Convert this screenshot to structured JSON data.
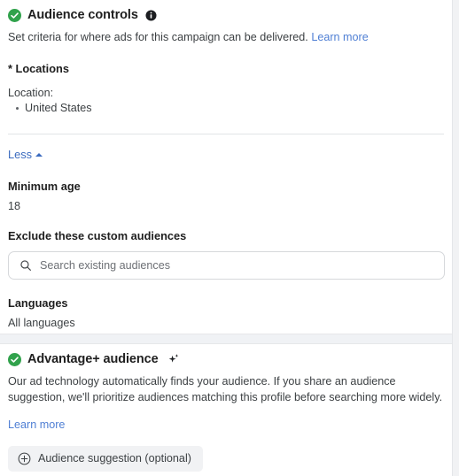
{
  "right_gutter": {
    "name": "page-scroll-gutter"
  },
  "audience_controls": {
    "status_icon": "green-check-circle-icon",
    "title": "Audience controls",
    "info_icon": "info-icon",
    "description": "Set criteria for where ads for this campaign can be delivered.",
    "learn_more": "Learn more",
    "locations_label": "* Locations",
    "location_sublabel": "Location:",
    "locations": [
      "United States"
    ],
    "less_label": "Less",
    "less_caret_icon": "caret-up-icon",
    "minimum_age_label": "Minimum age",
    "minimum_age_value": "18",
    "exclude_label": "Exclude these custom audiences",
    "search": {
      "icon": "search-icon",
      "placeholder": "Search existing audiences",
      "value": ""
    },
    "languages_label": "Languages",
    "languages_value": "All languages"
  },
  "advantage_audience": {
    "status_icon": "green-check-circle-icon",
    "title": "Advantage+ audience",
    "sparkle_icon": "sparkle-icon",
    "description": "Our ad technology automatically finds your audience. If you share an audience suggestion, we'll prioritize audiences matching this profile before searching more widely.",
    "learn_more": "Learn more",
    "suggestion_button": {
      "icon": "plus-circle-icon",
      "label": "Audience suggestion (optional)"
    }
  },
  "colors": {
    "accent_link": "#4f7fd4",
    "status_green": "#31a24c",
    "card_background": "#ffffff",
    "page_background": "#f0f2f5",
    "pill_background": "#f1f2f4"
  }
}
